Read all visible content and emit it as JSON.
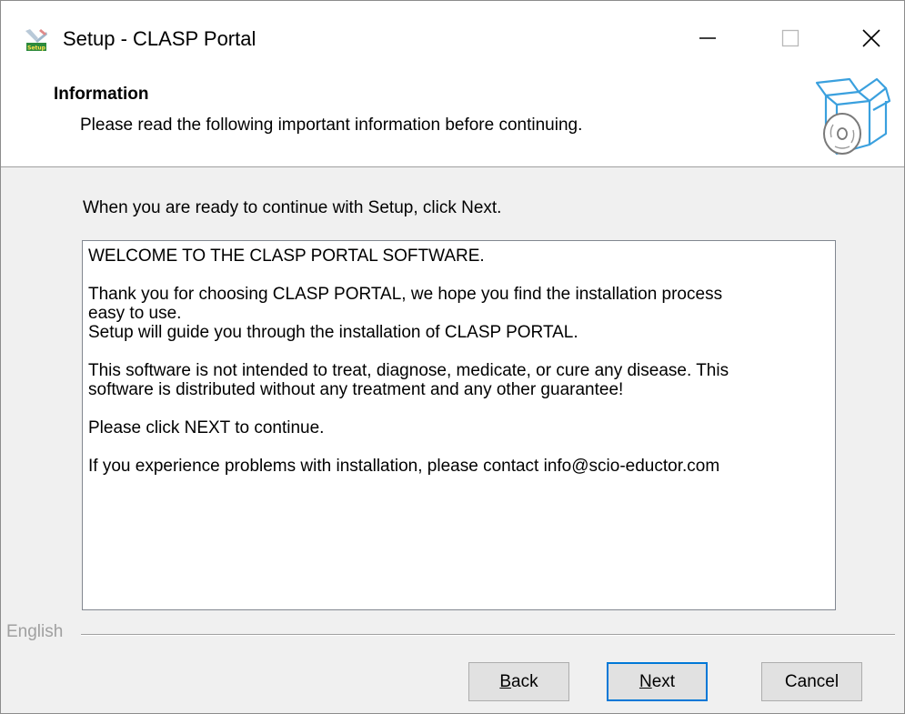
{
  "window": {
    "title": "Setup - CLASP Portal",
    "icon": "setup-icon",
    "controls": {
      "minimize": "minimize-icon",
      "maximize": "maximize-icon",
      "close": "close-icon"
    }
  },
  "header": {
    "title": "Information",
    "description": "Please read the following important information before continuing.",
    "icon": "install-box-icon"
  },
  "body": {
    "instructions": "When you are ready to continue with Setup, click Next.",
    "info_paragraphs": [
      "WELCOME TO THE CLASP PORTAL SOFTWARE.",
      "Thank you for choosing CLASP PORTAL, we hope you find the installation process\neasy to use.\nSetup will guide you through the installation of CLASP PORTAL.",
      "This software is not intended to treat, diagnose, medicate, or cure any disease. This\nsoftware is distributed without any treatment and any other guarantee!",
      "Please click NEXT to continue.",
      "If you experience problems with installation, please contact info@scio-eductor.com"
    ]
  },
  "footer": {
    "language_label": "English",
    "buttons": {
      "back": {
        "accel": "B",
        "rest": "ack"
      },
      "next": {
        "accel": "N",
        "rest": "ext"
      },
      "cancel": "Cancel"
    }
  },
  "colors": {
    "window_bg": "#f0f0f0",
    "panel_bg": "#ffffff",
    "default_button_border": "#0078d7",
    "icon_blue": "#3aa0de"
  }
}
